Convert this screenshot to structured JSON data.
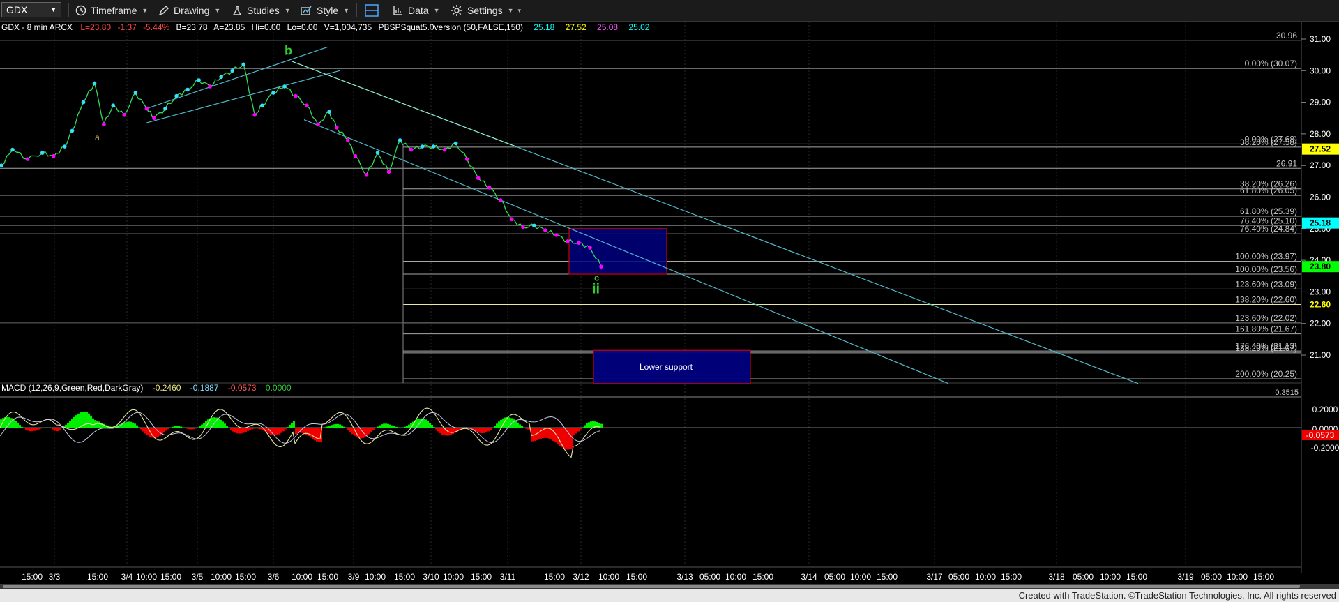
{
  "toolbar": {
    "symbol": "GDX",
    "timeframe": "Timeframe",
    "drawing": "Drawing",
    "studies": "Studies",
    "style": "Style",
    "data": "Data",
    "settings": "Settings"
  },
  "header": {
    "symbol_info": "GDX - 8 min  ARCX",
    "last": "L=23.80",
    "change": "-1.37",
    "pct": "-5.44%",
    "bid": "B=23.78",
    "ask": "A=23.85",
    "hi": "Hi=0.00",
    "lo": "Lo=0.00",
    "vol": "V=1,004,735",
    "study": "PBSPSquat5.0version (50,FALSE,150)",
    "v1": "25.18",
    "v2": "27.52",
    "v3": "25.08",
    "v4": "25.02"
  },
  "macd_header": {
    "label": "MACD (12,26,9,Green,Red,DarkGray)",
    "v1": "-0.2460",
    "v2": "-0.1887",
    "v3": "-0.0573",
    "v4": "0.0000"
  },
  "colors": {
    "up": "#00ff66",
    "down": "#ff00ff",
    "channel": "#4fb8c8",
    "fib": "#a8a8a8",
    "wave": "#33cc33",
    "box_fill": "#000080",
    "box_border": "#cc0000",
    "macd_pos": "#00ee00",
    "macd_neg": "#ee0000",
    "macd_line": "#e8e8a0",
    "macd_signal": "#c8c8e8"
  },
  "chart_data": {
    "type": "line",
    "title": "GDX - 8 min",
    "y_range": [
      20,
      31.3
    ],
    "y_ticks": [
      "31.00",
      "30.00",
      "29.00",
      "28.00",
      "27.00",
      "26.00",
      "25.00",
      "24.00",
      "23.00",
      "22.00",
      "21.00"
    ],
    "x_ticks": [
      "15:00",
      "3/3",
      "15:00",
      "3/4",
      "10:00",
      "15:00",
      "3/5",
      "10:00",
      "15:00",
      "3/6",
      "10:00",
      "15:00",
      "3/9",
      "10:00",
      "15:00",
      "3/10",
      "10:00",
      "15:00",
      "3/11",
      "15:00",
      "3/12",
      "10:00",
      "15:00",
      "3/13",
      "05:00",
      "10:00",
      "15:00",
      "3/14",
      "05:00",
      "10:00",
      "15:00",
      "3/17",
      "05:00",
      "10:00",
      "15:00",
      "3/18",
      "05:00",
      "10:00",
      "15:00",
      "3/19",
      "05:00",
      "10:00",
      "15:00"
    ],
    "price_series": {
      "name": "GDX",
      "x_bar": [
        0,
        6,
        14,
        22,
        28,
        34,
        38,
        44,
        50,
        55,
        60,
        66,
        72,
        78,
        82,
        88,
        94,
        100,
        106,
        112,
        118,
        124,
        130,
        136,
        140,
        146,
        152,
        158,
        164,
        170,
        176,
        180,
        186,
        190,
        196,
        202,
        208,
        214,
        220,
        226,
        232,
        238,
        244,
        250,
        256,
        262,
        268,
        274,
        280,
        286,
        292,
        298,
        304,
        310,
        316,
        322
      ],
      "close": [
        27.0,
        27.5,
        27.2,
        27.4,
        27.3,
        27.6,
        28.1,
        29.0,
        29.6,
        28.3,
        28.9,
        28.6,
        29.3,
        28.8,
        28.5,
        28.8,
        29.2,
        29.4,
        29.7,
        29.5,
        29.8,
        30.0,
        30.2,
        28.6,
        28.9,
        29.3,
        29.5,
        29.2,
        28.9,
        28.3,
        28.7,
        28.2,
        27.8,
        27.3,
        26.7,
        27.4,
        26.8,
        27.8,
        27.5,
        27.6,
        27.6,
        27.5,
        27.7,
        27.2,
        26.6,
        26.3,
        25.9,
        25.3,
        25.05,
        25.1,
        24.95,
        24.8,
        24.6,
        24.55,
        24.4,
        23.8
      ]
    },
    "horizontal_levels": [
      {
        "label": "30.96",
        "value": 30.96
      },
      {
        "label": "0.00% (30.07)",
        "value": 30.07
      },
      {
        "label": "0.00% (27.68)",
        "value": 27.68
      },
      {
        "label": "38.20% (27.58)",
        "value": 27.58
      },
      {
        "label": "26.91",
        "value": 26.91
      },
      {
        "label": "38.20% (26.26)",
        "value": 26.26
      },
      {
        "label": "61.80% (26.05)",
        "value": 26.05
      },
      {
        "label": "61.80% (25.39)",
        "value": 25.39
      },
      {
        "label": "76.40% (25.10)",
        "value": 25.1
      },
      {
        "label": "76.40% (24.84)",
        "value": 24.84
      },
      {
        "label": "100.00% (23.97)",
        "value": 23.97
      },
      {
        "label": "100.00% (23.56)",
        "value": 23.56
      },
      {
        "label": "123.60% (23.09)",
        "value": 23.09
      },
      {
        "label": "138.20% (22.60)",
        "value": 22.6
      },
      {
        "label": "123.60% (22.02)",
        "value": 22.02
      },
      {
        "label": "161.80% (21.67)",
        "value": 21.67
      },
      {
        "label": "176.40% (21.13)",
        "value": 21.13
      },
      {
        "label": "138.20% (21.07)",
        "value": 21.07
      },
      {
        "label": "200.00% (20.25)",
        "value": 20.25
      }
    ],
    "price_tags": [
      {
        "value": "27.52",
        "bg": "#ffff00",
        "fg": "#000",
        "price": 27.52
      },
      {
        "value": "25.18",
        "bg": "#00ffff",
        "fg": "#000",
        "price": 25.18
      },
      {
        "value": "23.80",
        "bg": "#00ff00",
        "fg": "#000",
        "price": 23.8
      },
      {
        "value": "22.60",
        "bg": "#000000",
        "fg": "#ffff00",
        "price": 22.6
      }
    ],
    "wave_labels": [
      "a",
      "b",
      "c",
      "ii"
    ],
    "target_box": {
      "label": "",
      "top": 25.0,
      "bottom": 23.56
    },
    "lower_support_box": {
      "label": "Lower support",
      "top": 21.15,
      "bottom": 20.1
    },
    "macd": {
      "y_ticks": [
        "0.2000",
        "0.0000",
        "-0.2000"
      ],
      "last_tag": "-0.0573",
      "top_tag": "0.3515"
    }
  },
  "footer": {
    "credit": "Created with TradeStation. ©TradeStation Technologies, Inc. All rights reserved"
  }
}
